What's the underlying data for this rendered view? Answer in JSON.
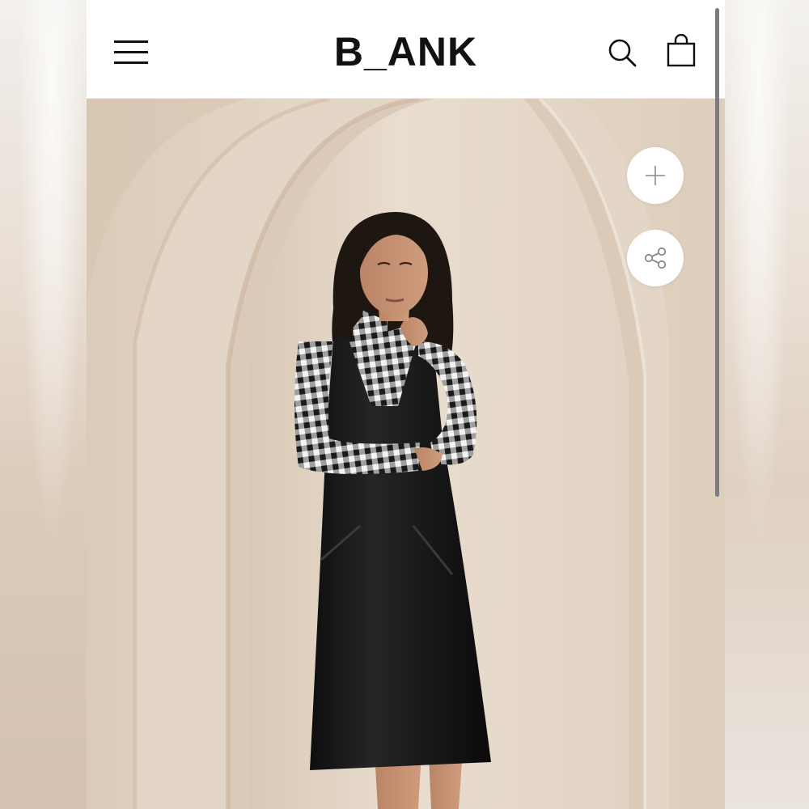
{
  "header": {
    "brand": "B_ANK"
  },
  "icons": {
    "menu": "hamburger-menu-icon",
    "search": "search-icon",
    "bag": "shopping-bag-icon",
    "add": "plus-icon",
    "share": "share-icon"
  },
  "colors": {
    "header_bg": "#ffffff",
    "brand_text": "#111111",
    "backdrop": "#e4d7c8",
    "dress": "#151515"
  },
  "image": {
    "subject": "model-in-black-velvet-pinafore-dress"
  }
}
